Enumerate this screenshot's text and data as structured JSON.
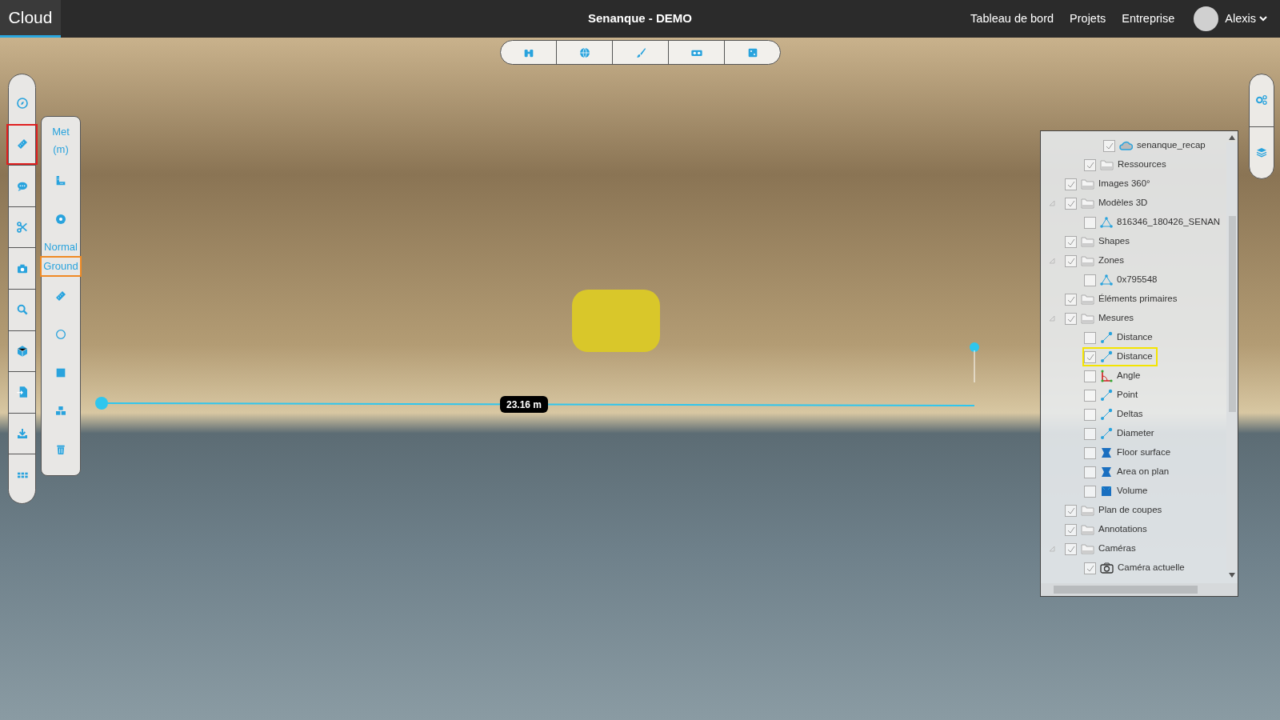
{
  "header": {
    "logo": "Cloud",
    "title": "Senanque - DEMO",
    "nav": [
      "Tableau de bord",
      "Projets",
      "Entreprise"
    ],
    "user": "Alexis"
  },
  "view_toolbar": [
    {
      "kind": "binoculars"
    },
    {
      "kind": "globe"
    },
    {
      "kind": "brush"
    },
    {
      "kind": "vr"
    },
    {
      "kind": "dice"
    }
  ],
  "tool_bar": [
    {
      "kind": "compass",
      "selected": false
    },
    {
      "kind": "ruler",
      "selected": true
    },
    {
      "kind": "comment",
      "selected": false
    },
    {
      "kind": "scissors",
      "selected": false
    },
    {
      "kind": "camera",
      "selected": false
    },
    {
      "kind": "search",
      "selected": false
    },
    {
      "kind": "cube",
      "selected": false
    },
    {
      "kind": "import",
      "selected": false
    },
    {
      "kind": "download",
      "selected": false
    },
    {
      "kind": "grid",
      "selected": false
    }
  ],
  "measure_bar": [
    {
      "kind": "text",
      "label": "Met (m)",
      "selected": false
    },
    {
      "kind": "angle-ruler",
      "selected": false
    },
    {
      "kind": "dot",
      "selected": false
    },
    {
      "kind": "text",
      "label": "Normal",
      "selected": false
    },
    {
      "kind": "text",
      "label": "Ground",
      "selected": true
    },
    {
      "kind": "ruler",
      "selected": false
    },
    {
      "kind": "circle",
      "selected": false
    },
    {
      "kind": "square",
      "selected": false
    },
    {
      "kind": "cubes",
      "selected": false
    },
    {
      "kind": "trash",
      "selected": false
    }
  ],
  "right_toolbar": [
    {
      "kind": "settings"
    },
    {
      "kind": "layers"
    }
  ],
  "measurement": {
    "label": "23.16 m"
  },
  "tree": {
    "items": [
      {
        "children": [
          {
            "children": [
              {
                "label": "senanque_recap",
                "kind": "cloud",
                "checked": true,
                "selected": false
              }
            ]
          },
          {
            "label": "Ressources",
            "kind": "folder",
            "checked": true,
            "selected": false
          }
        ]
      },
      {
        "label": "Images 360°",
        "kind": "folder",
        "checked": true,
        "selected": false
      },
      {
        "label": "Modèles 3D",
        "kind": "folder",
        "checked": true,
        "selected": false,
        "expanded": true,
        "children": [
          {
            "label": "816346_180426_SENAN",
            "kind": "mesh",
            "checked": false,
            "selected": false
          }
        ]
      },
      {
        "label": "Shapes",
        "kind": "folder",
        "checked": true,
        "selected": false
      },
      {
        "label": "Zones",
        "kind": "folder",
        "checked": true,
        "selected": false,
        "expanded": true,
        "children": [
          {
            "label": "0x795548",
            "kind": "mesh",
            "checked": false,
            "selected": false
          }
        ]
      },
      {
        "label": "Éléments primaires",
        "kind": "folder",
        "checked": true,
        "selected": false
      },
      {
        "label": "Mesures",
        "kind": "folder",
        "checked": true,
        "selected": false,
        "expanded": true,
        "children": [
          {
            "label": "Distance",
            "kind": "line",
            "checked": false,
            "selected": false
          },
          {
            "label": "Distance",
            "kind": "line",
            "checked": true,
            "selected": true
          },
          {
            "label": "Angle",
            "kind": "angle",
            "checked": false,
            "selected": false
          },
          {
            "label": "Point",
            "kind": "line",
            "checked": false,
            "selected": false
          },
          {
            "label": "Deltas",
            "kind": "line",
            "checked": false,
            "selected": false
          },
          {
            "label": "Diameter",
            "kind": "line",
            "checked": false,
            "selected": false
          },
          {
            "label": "Floor surface",
            "kind": "surface",
            "checked": false,
            "selected": false
          },
          {
            "label": "Area on plan",
            "kind": "surface",
            "checked": false,
            "selected": false
          },
          {
            "label": "Volume",
            "kind": "volume",
            "checked": false,
            "selected": false
          }
        ]
      },
      {
        "label": "Plan de coupes",
        "kind": "folder",
        "checked": true,
        "selected": false
      },
      {
        "label": "Annotations",
        "kind": "folder",
        "checked": true,
        "selected": false
      },
      {
        "label": "Caméras",
        "kind": "folder",
        "checked": true,
        "selected": false,
        "expanded": true,
        "children": [
          {
            "label": "Caméra actuelle",
            "kind": "camera",
            "checked": true,
            "selected": false
          }
        ]
      }
    ]
  }
}
